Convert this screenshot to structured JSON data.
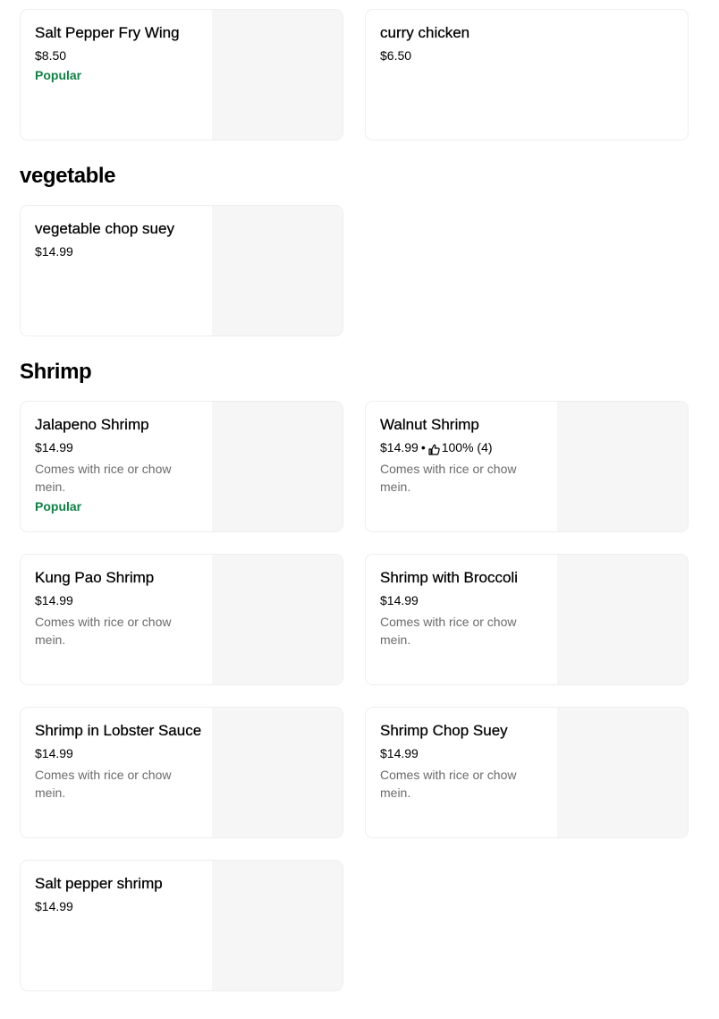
{
  "top": {
    "items": [
      {
        "name": "Salt Pepper Fry Wing",
        "price": "$8.50",
        "badge": "Popular"
      },
      {
        "name": "curry chicken",
        "price": "$6.50"
      }
    ]
  },
  "vegetable": {
    "title": "vegetable",
    "items": [
      {
        "name": "vegetable chop suey",
        "price": "$14.99"
      }
    ]
  },
  "shrimp": {
    "title": "Shrimp",
    "items": [
      {
        "name": "Jalapeno Shrimp",
        "price": "$14.99",
        "description": "Comes with rice or chow mein.",
        "badge": "Popular"
      },
      {
        "name": "Walnut Shrimp",
        "price": "$14.99",
        "separator": "•",
        "rating": "100% (4)",
        "description": "Comes with rice or chow mein."
      },
      {
        "name": "Kung Pao Shrimp",
        "price": "$14.99",
        "description": "Comes with rice or chow mein."
      },
      {
        "name": "Shrimp with Broccoli",
        "price": "$14.99",
        "description": "Comes with rice or chow mein."
      },
      {
        "name": "Shrimp in Lobster Sauce",
        "price": "$14.99",
        "description": "Comes with rice or chow mein."
      },
      {
        "name": "Shrimp Chop Suey",
        "price": "$14.99",
        "description": "Comes with rice or chow mein."
      },
      {
        "name": "Salt pepper shrimp",
        "price": "$14.99"
      }
    ]
  },
  "icons": {
    "rating": "thumbs-up-icon"
  },
  "colors": {
    "popular": "#0e8345",
    "description": "#6b6b6b",
    "image_placeholder": "#f6f6f6",
    "card_border": "#eeeeee"
  }
}
